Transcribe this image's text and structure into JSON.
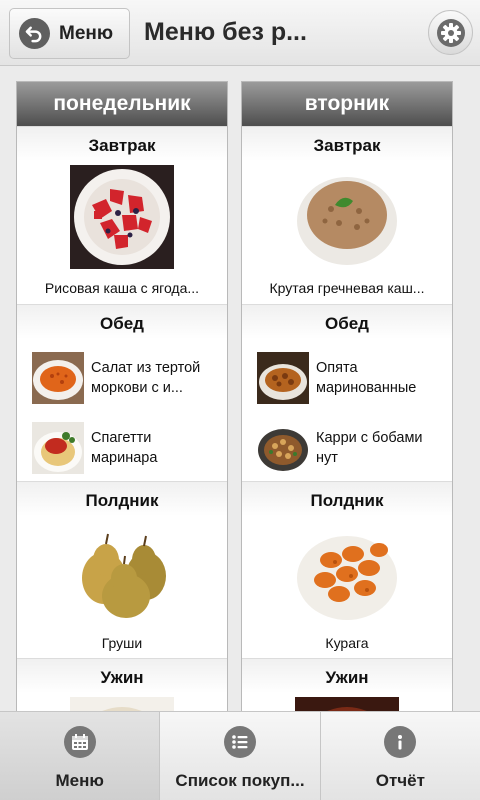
{
  "header": {
    "back_label": "Меню",
    "title": "Меню без р..."
  },
  "days": [
    {
      "name": "понедельник",
      "breakfast": {
        "title": "Завтрак",
        "caption": "Рисовая каша с ягода..."
      },
      "lunch": {
        "title": "Обед",
        "items": [
          "Салат из тертой моркови с и...",
          "Спагетти маринара"
        ]
      },
      "snack": {
        "title": "Полдник",
        "caption": "Груши"
      },
      "dinner": {
        "title": "Ужин"
      }
    },
    {
      "name": "вторник",
      "breakfast": {
        "title": "Завтрак",
        "caption": "Крутая гречневая каш..."
      },
      "lunch": {
        "title": "Обед",
        "items": [
          "Опята маринованные",
          "Карри с бобами нут"
        ]
      },
      "snack": {
        "title": "Полдник",
        "caption": "Курага"
      },
      "dinner": {
        "title": "Ужин"
      }
    }
  ],
  "bottom_nav": {
    "menu": "Меню",
    "shopping": "Список покуп...",
    "report": "Отчёт"
  },
  "icons": {
    "back": "back-arrow-icon",
    "settings": "gear-icon",
    "menu": "calendar-icon",
    "shopping": "list-icon",
    "report": "info-icon"
  }
}
